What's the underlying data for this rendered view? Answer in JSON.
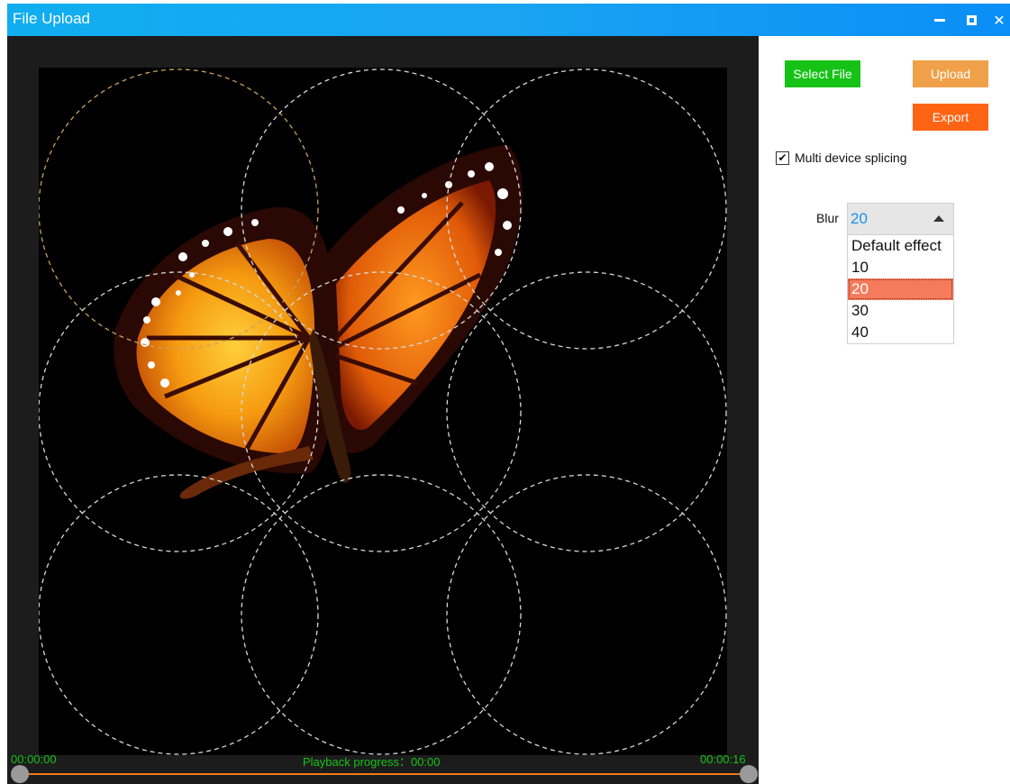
{
  "window": {
    "title": "File Upload"
  },
  "player": {
    "time_start": "00:00:00",
    "time_end": "00:00:16",
    "progress_label": "Playback progress：00:00",
    "progress_fraction": 0
  },
  "toolbar": {
    "select_file_label": "Select File",
    "upload_label": "Upload",
    "export_label": "Export"
  },
  "options": {
    "multi_device_label": "Multi device splicing",
    "multi_device_checked": true
  },
  "blur": {
    "label": "Blur",
    "selected_value": "20",
    "options": [
      "Default effect",
      "10",
      "20",
      "30",
      "40"
    ],
    "selected_index": 2
  },
  "colors": {
    "title_bar": "#10aef0",
    "select_button": "#16c216",
    "upload_button": "#f0a048",
    "export_button": "#ff6414",
    "progress_text": "#17c217",
    "progress_track": "#f07a1c",
    "selected_option": "#f57b5c"
  }
}
